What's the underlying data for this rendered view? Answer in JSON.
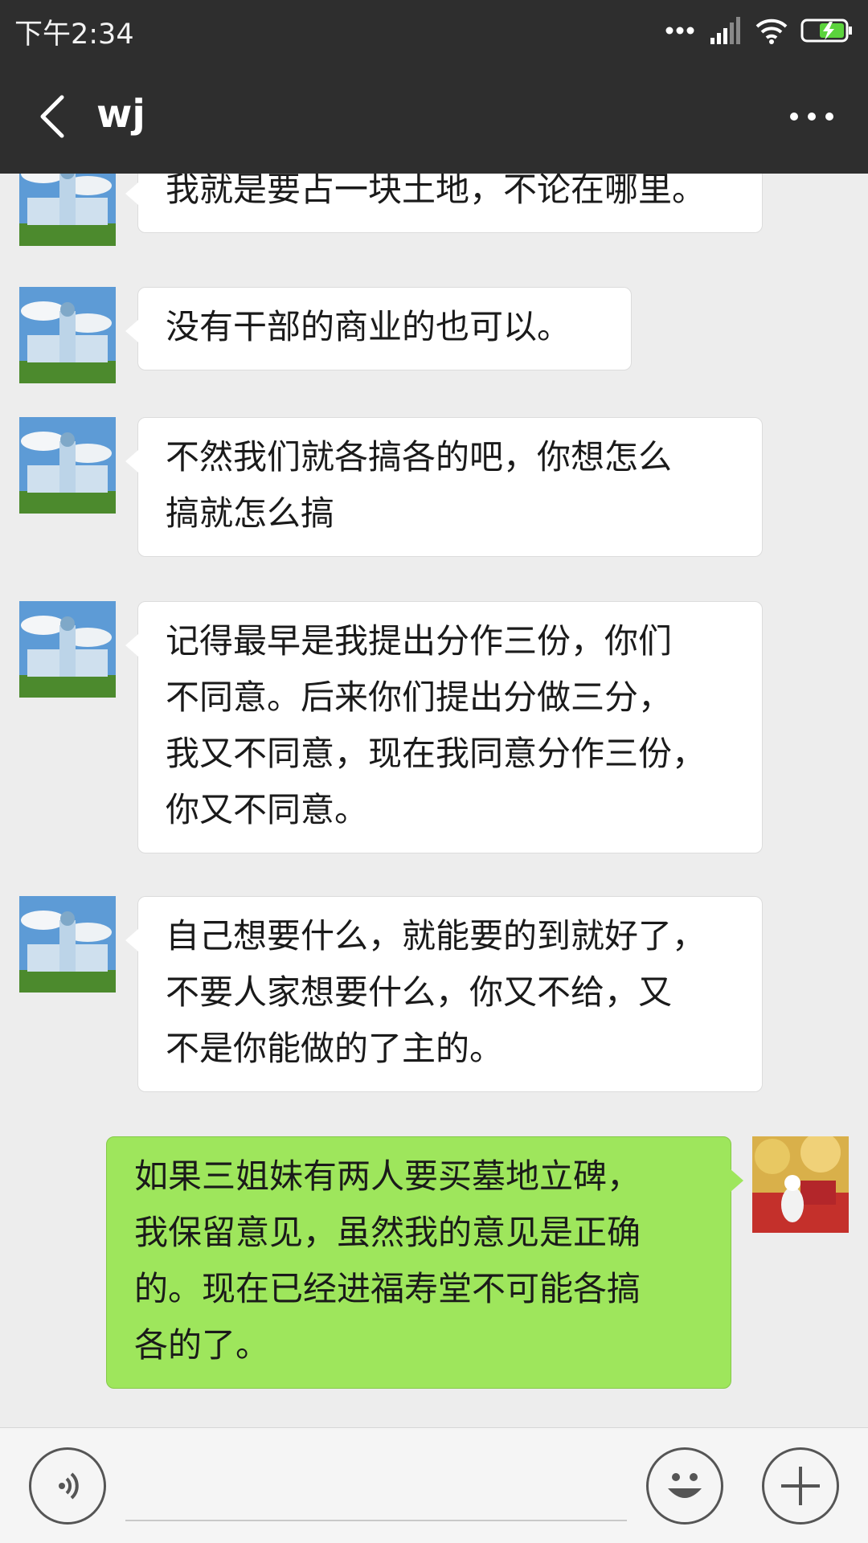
{
  "status_bar": {
    "time": "下午2:34"
  },
  "header": {
    "title": "wj",
    "back_icon": "chevron-left-icon",
    "more_icon": "more-dots-icon"
  },
  "messages": [
    {
      "side": "left",
      "text": "我就是要占一块土地，不论在哪里。"
    },
    {
      "side": "left",
      "text": "没有干部的商业的也可以。"
    },
    {
      "side": "left",
      "text": "不然我们就各搞各的吧，你想怎么\n搞就怎么搞"
    },
    {
      "side": "left",
      "text": "记得最早是我提出分作三份，你们\n不同意。后来你们提出分做三分，\n我又不同意，现在我同意分作三份，\n你又不同意。"
    },
    {
      "side": "left",
      "text": "自己想要什么，就能要的到就好了，\n不要人家想要什么，你又不给，又\n不是你能做的了主的。"
    },
    {
      "side": "right",
      "text": "如果三姐妹有两人要买墓地立碑，\n我保留意见，虽然我的意见是正确\n的。现在已经进福寿堂不可能各搞\n各的了。"
    }
  ],
  "colors": {
    "header_bg": "#2e2e2e",
    "chat_bg": "#ededed",
    "sent_bubble": "#9ee65c",
    "received_bubble": "#ffffff"
  },
  "input_bar": {
    "voice_icon": "voice-icon",
    "emoji_icon": "emoji-icon",
    "plus_icon": "plus-icon",
    "input_value": ""
  }
}
